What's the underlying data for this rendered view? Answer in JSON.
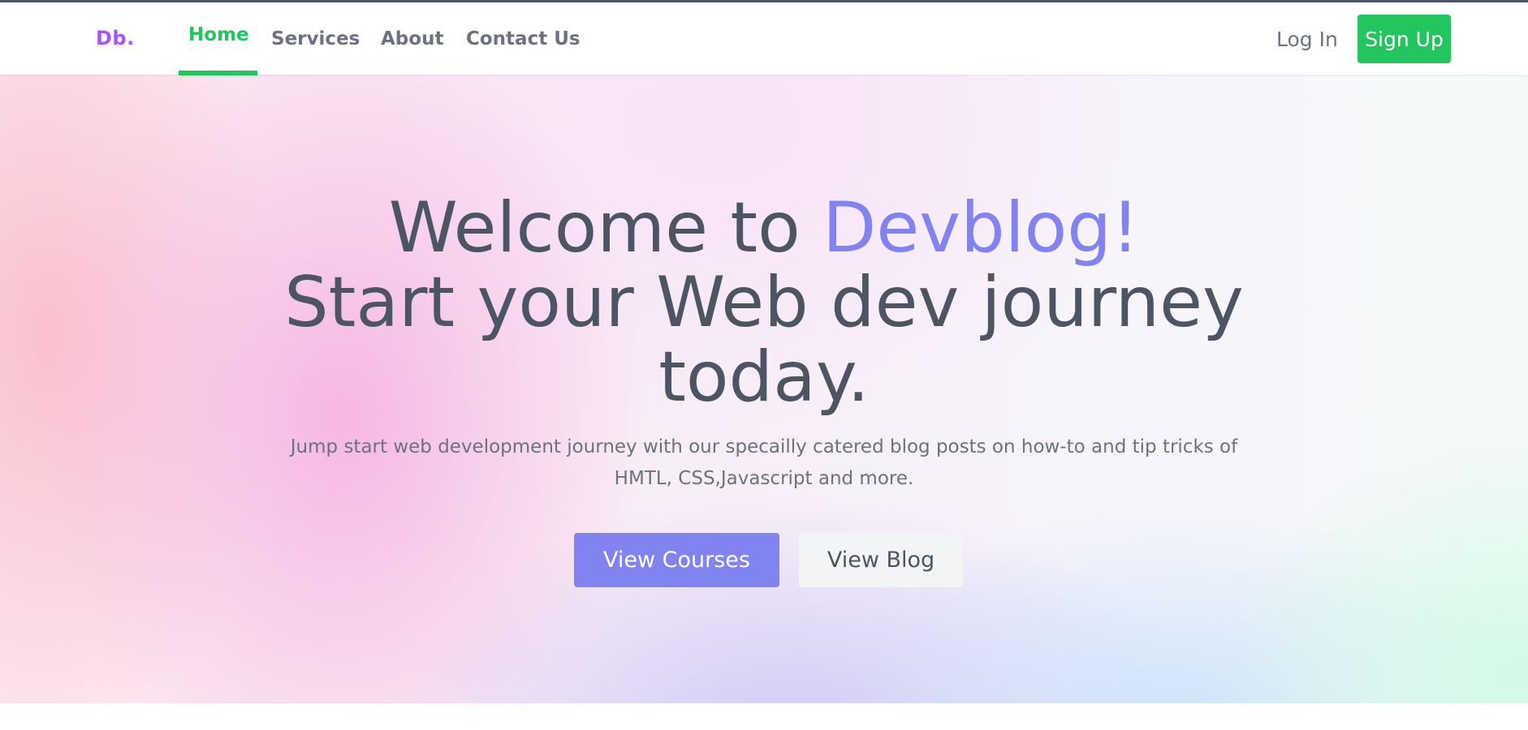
{
  "navbar": {
    "logo": "Db.",
    "links": [
      {
        "label": "Home",
        "active": true
      },
      {
        "label": "Services",
        "active": false
      },
      {
        "label": "About",
        "active": false
      },
      {
        "label": "Contact Us",
        "active": false
      }
    ],
    "login_label": "Log In",
    "signup_label": "Sign Up"
  },
  "hero": {
    "headline_prefix": "Welcome to ",
    "headline_accent": "Devblog!",
    "headline_line2": "Start your Web dev journey",
    "headline_line3": "today.",
    "subtext": "Jump start web development journey with our specailly catered blog posts on how-to and tip tricks of HMTL, CSS,Javascript and more.",
    "primary_button": "View Courses",
    "secondary_button": "View Blog"
  },
  "colors": {
    "brand_green": "#22c55e",
    "logo_purple": "#a855f7",
    "accent_indigo": "#8184f0",
    "text_gray": "#4b5563"
  }
}
